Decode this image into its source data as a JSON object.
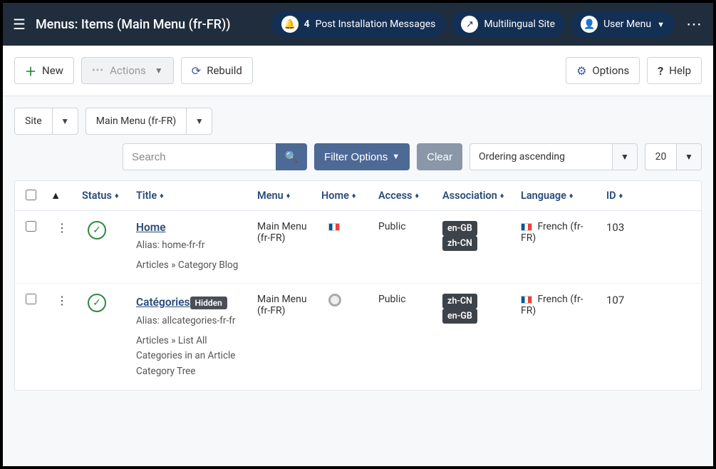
{
  "header": {
    "title": "Menus: Items (Main Menu (fr-FR))",
    "notifications_count": "4",
    "notifications_label": "Post Installation Messages",
    "site_label": "Multilingual Site",
    "user_menu_label": "User Menu"
  },
  "toolbar": {
    "new_label": "New",
    "actions_label": "Actions",
    "rebuild_label": "Rebuild",
    "options_label": "Options",
    "help_label": "Help"
  },
  "filters": {
    "client": "Site",
    "menu": "Main Menu (fr-FR)",
    "search_placeholder": "Search",
    "filter_options_label": "Filter Options",
    "clear_label": "Clear",
    "ordering": "Ordering ascending",
    "limit": "20"
  },
  "columns": {
    "status": "Status",
    "title": "Title",
    "menu": "Menu",
    "home": "Home",
    "access": "Access",
    "association": "Association",
    "language": "Language",
    "id": "ID"
  },
  "rows": [
    {
      "title": "Home",
      "hidden": false,
      "alias": "Alias: home-fr-fr",
      "path": "Articles » Category Blog",
      "menu": "Main Menu (fr-FR)",
      "home_is_flag": true,
      "access": "Public",
      "assoc": [
        "en-GB",
        "zh-CN"
      ],
      "language": "French (fr-FR)",
      "id": "103"
    },
    {
      "title": "Catégories",
      "hidden": true,
      "hidden_label": "Hidden",
      "alias": "Alias: allcategories-fr-fr",
      "path": "Articles » List All Categories in an Article Category Tree",
      "menu": "Main Menu (fr-FR)",
      "home_is_flag": false,
      "access": "Public",
      "assoc": [
        "zh-CN",
        "en-GB"
      ],
      "language": "French (fr-FR)",
      "id": "107"
    }
  ]
}
